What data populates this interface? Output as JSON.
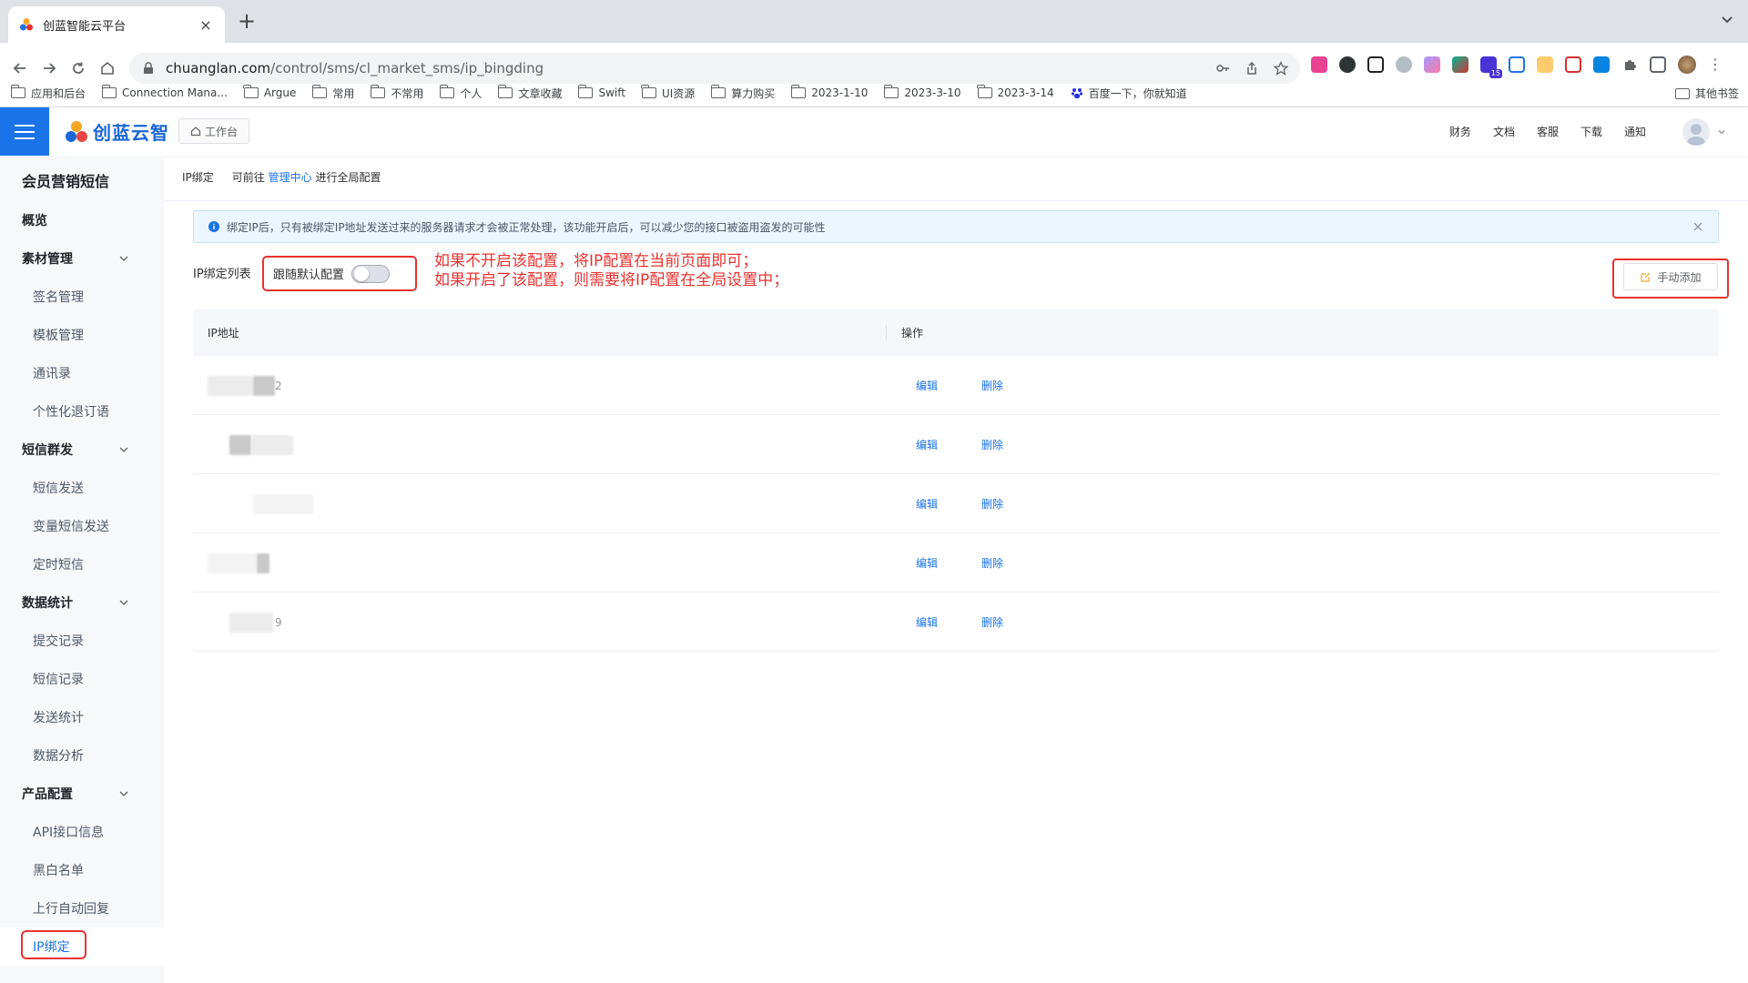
{
  "browser": {
    "tab_title": "创蓝智能云平台",
    "url_host": "chuanglan.com",
    "url_path": "/control/sms/cl_market_sms/ip_bingding",
    "bookmarks": [
      "应用和后台",
      "Connection Mana...",
      "Argue",
      "常用",
      "不常用",
      "个人",
      "文章收藏",
      "Swift",
      "UI资源",
      "算力购买",
      "2023-1-10",
      "2023-3-10",
      "2023-3-14",
      "百度一下，你就知道"
    ],
    "other_bookmarks": "其他书签",
    "extension_badge": "15"
  },
  "header": {
    "logo_text": "创蓝云智",
    "workbench": "工作台",
    "nav": [
      "财务",
      "文档",
      "客服",
      "下载",
      "通知"
    ]
  },
  "sidebar": {
    "title": "会员营销短信",
    "items": [
      {
        "label": "概览",
        "type": "group"
      },
      {
        "label": "素材管理",
        "type": "group",
        "expandable": true
      },
      {
        "label": "签名管理",
        "type": "sub"
      },
      {
        "label": "模板管理",
        "type": "sub"
      },
      {
        "label": "通讯录",
        "type": "sub"
      },
      {
        "label": "个性化退订语",
        "type": "sub"
      },
      {
        "label": "短信群发",
        "type": "group",
        "expandable": true
      },
      {
        "label": "短信发送",
        "type": "sub"
      },
      {
        "label": "变量短信发送",
        "type": "sub"
      },
      {
        "label": "定时短信",
        "type": "sub"
      },
      {
        "label": "数据统计",
        "type": "group",
        "expandable": true
      },
      {
        "label": "提交记录",
        "type": "sub"
      },
      {
        "label": "短信记录",
        "type": "sub"
      },
      {
        "label": "发送统计",
        "type": "sub"
      },
      {
        "label": "数据分析",
        "type": "sub"
      },
      {
        "label": "产品配置",
        "type": "group",
        "expandable": true
      },
      {
        "label": "API接口信息",
        "type": "sub"
      },
      {
        "label": "黑白名单",
        "type": "sub"
      },
      {
        "label": "上行自动回复",
        "type": "sub"
      },
      {
        "label": "IP绑定",
        "type": "sub",
        "active": true
      }
    ]
  },
  "main": {
    "breadcrumb": {
      "current": "IP绑定",
      "prefix": "可前往",
      "link": "管理中心",
      "suffix": "进行全局配置"
    },
    "alert": "绑定IP后，只有被绑定IP地址发送过来的服务器请求才会被正常处理，该功能开启后，可以减少您的接口被盗用盗发的可能性",
    "list_label": "IP绑定列表",
    "follow_default_label": "跟随默认配置",
    "follow_default_on": false,
    "annotation_line1": "如果不开启该配置，将IP配置在当前页面即可；",
    "annotation_line2": "如果开启了该配置，则需要将IP配置在全局设置中；",
    "add_button": "手动添加",
    "table": {
      "columns": [
        "IP地址",
        "操作"
      ],
      "rows": [
        {
          "ip_tail": "2",
          "edit": "编辑",
          "delete": "删除"
        },
        {
          "ip_tail": "",
          "edit": "编辑",
          "delete": "删除"
        },
        {
          "ip_tail": "",
          "edit": "编辑",
          "delete": "删除"
        },
        {
          "ip_tail": "",
          "edit": "编辑",
          "delete": "删除"
        },
        {
          "ip_tail": "9",
          "edit": "编辑",
          "delete": "删除"
        }
      ]
    }
  },
  "colors": {
    "primary": "#1a73e8",
    "annotation_red": "#e8322f",
    "sidebar_bg": "#f7f8fa",
    "alert_bg": "#ecf6ff"
  }
}
